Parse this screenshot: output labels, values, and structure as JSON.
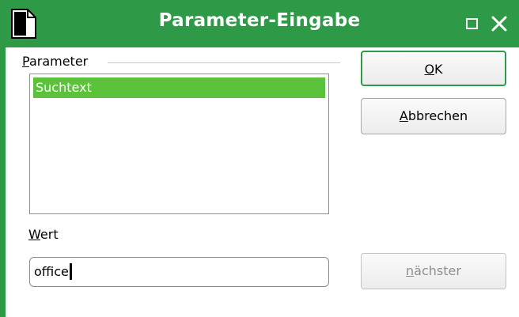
{
  "window": {
    "title": "Parameter-Eingabe",
    "accent_color": "#2e9a47",
    "app_icon": "document-icon",
    "controls": [
      "maximize-icon",
      "close-icon"
    ]
  },
  "parameters": {
    "label_accel": "P",
    "label_rest": "arameter",
    "items": [
      "Suchtext"
    ],
    "selected_color": "#5cc23b"
  },
  "value": {
    "label_accel": "W",
    "label_rest": "ert",
    "current_value": "office"
  },
  "buttons": {
    "ok": {
      "accel": "O",
      "rest": "K"
    },
    "cancel": {
      "accel": "A",
      "rest": "bbrechen"
    },
    "next": {
      "accel": "n",
      "rest": "ächster",
      "enabled": false
    }
  }
}
